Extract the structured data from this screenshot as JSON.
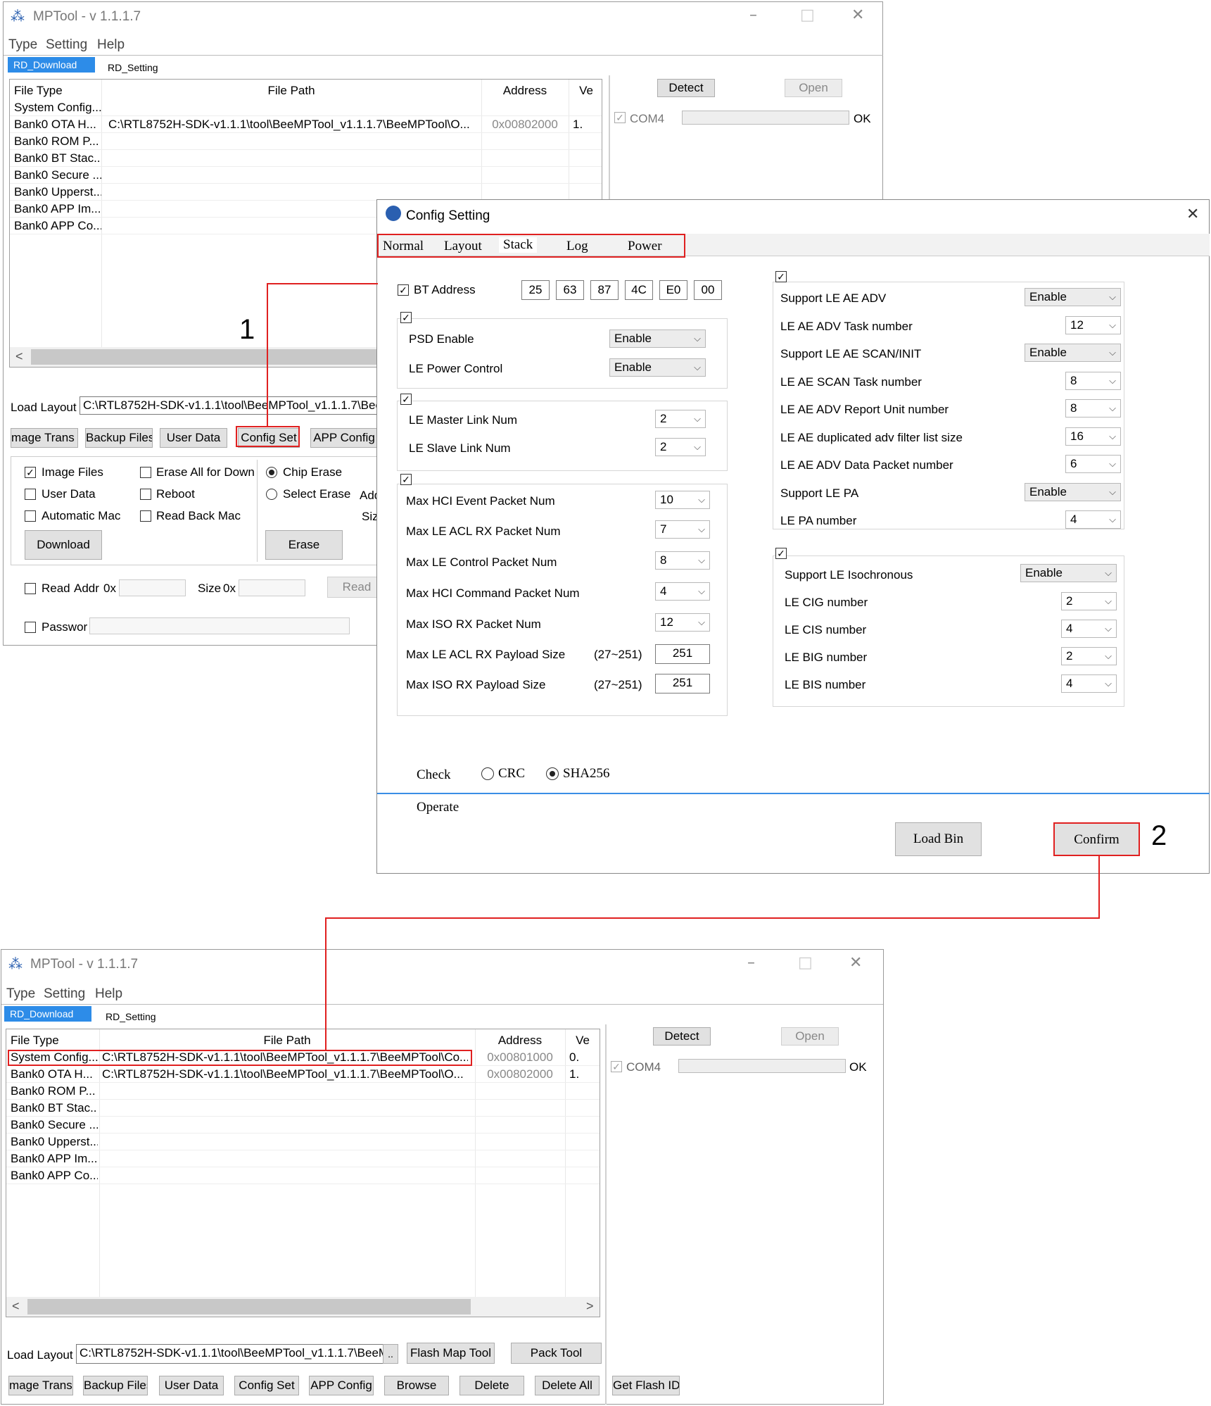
{
  "top_window": {
    "title": "MPTool - v 1.1.1.7",
    "menu": [
      "Type",
      "Setting",
      "Help"
    ],
    "tabs": [
      "RD_Download",
      "RD_Setting"
    ],
    "columns": [
      "File Type",
      "File Path",
      "Address",
      "Ve"
    ],
    "rows": [
      {
        "type": "System Config...",
        "path": "",
        "address": "",
        "ver": ""
      },
      {
        "type": "Bank0 OTA H...",
        "path": "C:\\RTL8752H-SDK-v1.1.1\\tool\\BeeMPTool_v1.1.1.7\\BeeMPTool\\O...",
        "address": "0x00802000",
        "ver": "1."
      },
      {
        "type": "Bank0 ROM P...",
        "path": "",
        "address": "",
        "ver": ""
      },
      {
        "type": "Bank0 BT Stac...",
        "path": "",
        "address": "",
        "ver": ""
      },
      {
        "type": "Bank0 Secure ...",
        "path": "",
        "address": "",
        "ver": ""
      },
      {
        "type": "Bank0 Upperst...",
        "path": "",
        "address": "",
        "ver": ""
      },
      {
        "type": "Bank0 APP Im...",
        "path": "",
        "address": "",
        "ver": ""
      },
      {
        "type": "Bank0 APP Co...",
        "path": "",
        "address": "",
        "ver": ""
      }
    ],
    "scroll_left": "<",
    "detect": "Detect",
    "open": "Open",
    "com": "COM4",
    "ok": "OK",
    "load_layout_label": "Load Layout",
    "load_layout_value": "C:\\RTL8752H-SDK-v1.1.1\\tool\\BeeMPTool_v1.1.1.7\\BeeM",
    "buttons": [
      "mage Trans",
      "Backup Files",
      "User Data",
      "Config Set",
      "APP Config"
    ],
    "opts": {
      "image_files": "Image Files",
      "erase_all": "Erase All for Down",
      "chip_erase": "Chip Erase",
      "user_data": "User Data",
      "reboot": "Reboot",
      "select_erase": "Select Erase",
      "add": "Add",
      "automatic_mac": "Automatic Mac",
      "read_back_mac": "Read Back Mac",
      "siz": "Siz"
    },
    "download": "Download",
    "erase": "Erase",
    "read": "Read",
    "addr": "Addr",
    "hex": "0x",
    "size": "Size",
    "read_btn": "Read",
    "password": "Passwor"
  },
  "callouts": {
    "one": "1",
    "two": "2"
  },
  "dialog": {
    "title": "Config Setting",
    "tabs": [
      "Normal",
      "Layout",
      "Stack",
      "Log",
      "Power"
    ],
    "bt_address_label": "BT Address",
    "bt_address": [
      "25",
      "63",
      "87",
      "4C",
      "E0",
      "00"
    ],
    "left": {
      "psd_enable": "PSD Enable",
      "psd_val": "Enable",
      "le_power": "LE Power Control",
      "le_power_val": "Enable",
      "master": "LE Master Link Num",
      "master_val": "2",
      "slave": "LE Slave Link Num",
      "slave_val": "2",
      "hci_evt": "Max HCI Event Packet Num",
      "hci_evt_val": "10",
      "acl_rx": "Max LE ACL RX Packet Num",
      "acl_rx_val": "7",
      "ctrl": "Max LE Control Packet Num",
      "ctrl_val": "8",
      "hci_cmd": "Max HCI Command Packet Num",
      "hci_cmd_val": "4",
      "iso_rx": "Max ISO RX Packet Num",
      "iso_rx_val": "12",
      "acl_payload": "Max LE ACL RX Payload Size",
      "acl_range": "(27~251)",
      "acl_payload_val": "251",
      "iso_payload": "Max ISO RX Payload Size",
      "iso_range": "(27~251)",
      "iso_payload_val": "251"
    },
    "right": {
      "ae_adv": "Support LE AE ADV",
      "ae_adv_val": "Enable",
      "ae_adv_task": "LE AE ADV Task number",
      "ae_adv_task_val": "12",
      "ae_scan": "Support LE AE SCAN/INIT",
      "ae_scan_val": "Enable",
      "ae_scan_task": "LE AE SCAN Task number",
      "ae_scan_task_val": "8",
      "ae_report": "LE AE ADV Report Unit number",
      "ae_report_val": "8",
      "ae_dup": "LE AE duplicated adv filter list size",
      "ae_dup_val": "16",
      "ae_data": "LE AE ADV Data Packet number",
      "ae_data_val": "6",
      "pa": "Support LE PA",
      "pa_val": "Enable",
      "pa_num": "LE PA number",
      "pa_num_val": "4",
      "iso": "Support LE Isochronous",
      "iso_val": "Enable",
      "cig": "LE CIG number",
      "cig_val": "2",
      "cis": "LE CIS number",
      "cis_val": "4",
      "big": "LE BIG number",
      "big_val": "2",
      "bis": "LE BIS number",
      "bis_val": "4"
    },
    "check_label": "Check",
    "crc": "CRC",
    "sha": "SHA256",
    "operate_label": "Operate",
    "load_bin": "Load Bin",
    "confirm": "Confirm"
  },
  "bottom_window": {
    "title": "MPTool - v 1.1.1.7",
    "menu": [
      "Type",
      "Setting",
      "Help"
    ],
    "tabs": [
      "RD_Download",
      "RD_Setting"
    ],
    "columns": [
      "File Type",
      "File Path",
      "Address",
      "Ve"
    ],
    "rows": [
      {
        "type": "System Config...",
        "path": "C:\\RTL8752H-SDK-v1.1.1\\tool\\BeeMPTool_v1.1.1.7\\BeeMPTool\\Co...",
        "address": "0x00801000",
        "ver": "0."
      },
      {
        "type": "Bank0 OTA H...",
        "path": "C:\\RTL8752H-SDK-v1.1.1\\tool\\BeeMPTool_v1.1.1.7\\BeeMPTool\\O...",
        "address": "0x00802000",
        "ver": "1."
      },
      {
        "type": "Bank0 ROM P...",
        "path": "",
        "address": "",
        "ver": ""
      },
      {
        "type": "Bank0 BT Stac...",
        "path": "",
        "address": "",
        "ver": ""
      },
      {
        "type": "Bank0 Secure ...",
        "path": "",
        "address": "",
        "ver": ""
      },
      {
        "type": "Bank0 Upperst...",
        "path": "",
        "address": "",
        "ver": ""
      },
      {
        "type": "Bank0 APP Im...",
        "path": "",
        "address": "",
        "ver": ""
      },
      {
        "type": "Bank0 APP Co...",
        "path": "",
        "address": "",
        "ver": ""
      }
    ],
    "scroll_left": "<",
    "scroll_right": ">",
    "detect": "Detect",
    "open": "Open",
    "com": "COM4",
    "ok": "OK",
    "load_layout_label": "Load Layout",
    "load_layout_value": "C:\\RTL8752H-SDK-v1.1.1\\tool\\BeeMPTool_v1.1.1.7\\BeeM",
    "browse_dots": "..",
    "flash_map": "Flash Map Tool",
    "pack_tool": "Pack Tool",
    "buttons": [
      "mage Trans",
      "Backup Files",
      "User Data",
      "Config Set",
      "APP Config",
      "Browse",
      "Delete",
      "Delete All"
    ],
    "get_flash": "Get Flash ID"
  },
  "colors": {
    "accent": "#2d8ce8",
    "highlight": "#e02020"
  }
}
